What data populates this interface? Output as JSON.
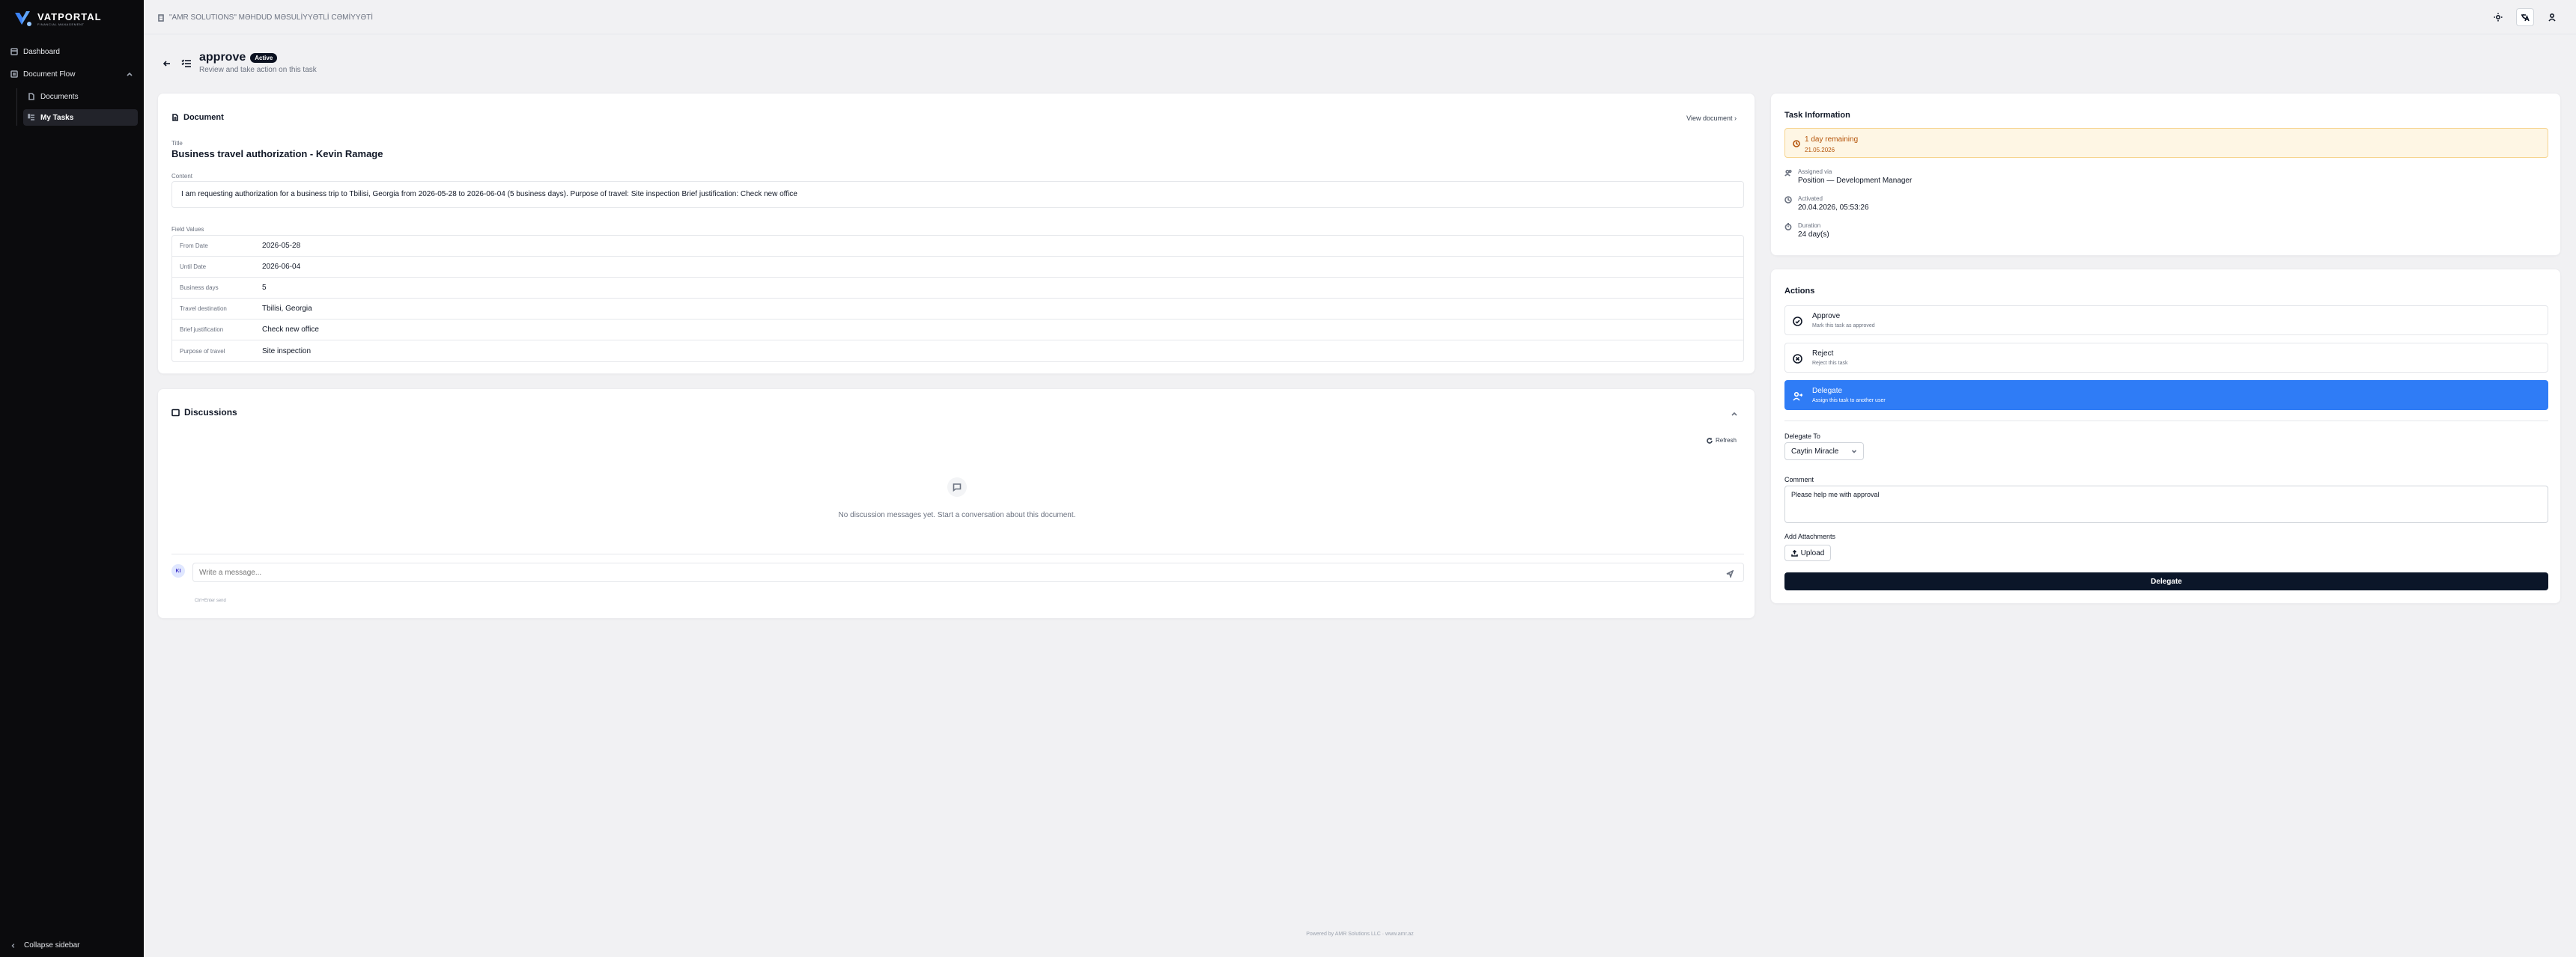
{
  "brand": {
    "name": "VATPORTAL",
    "tagline": "FINANCIAL MANAGEMENT"
  },
  "sidebar": {
    "items": [
      {
        "label": "Dashboard"
      },
      {
        "label": "Document Flow"
      },
      {
        "label": "Documents"
      },
      {
        "label": "My Tasks"
      }
    ],
    "collapse_label": "Collapse sidebar"
  },
  "topbar": {
    "company": "\"AMR SOLUTIONS\" MƏHDUD MƏSULİYYƏTLİ CƏMİYYƏTİ"
  },
  "header": {
    "title": "approve",
    "badge": "Active",
    "subtitle": "Review and take action on this task"
  },
  "document": {
    "heading": "Document",
    "view_label": "View document",
    "title_label": "Title",
    "title": "Business travel authorization - Kevin Ramage",
    "content_label": "Content",
    "content": "I am requesting authorization for a business trip to Tbilisi, Georgia from 2026-05-28 to 2026-06-04 (5 business days). Purpose of travel: Site inspection Brief justification: Check new office",
    "fields_label": "Field Values",
    "fields": [
      {
        "key": "From Date",
        "value": "2026-05-28"
      },
      {
        "key": "Until Date",
        "value": "2026-06-04"
      },
      {
        "key": "Business days",
        "value": "5"
      },
      {
        "key": "Travel destination",
        "value": "Tbilisi, Georgia"
      },
      {
        "key": "Brief justification",
        "value": "Check new office"
      },
      {
        "key": "Purpose of travel",
        "value": "Site inspection"
      }
    ]
  },
  "discussions": {
    "heading": "Discussions",
    "refresh_label": "Refresh",
    "empty_text": "No discussion messages yet. Start a conversation about this document.",
    "avatar_initials": "KI",
    "input_placeholder": "Write a message...",
    "hint": "Ctrl+Enter send"
  },
  "task_info": {
    "heading": "Task Information",
    "remaining": "1 day remaining",
    "deadline": "21.05.2026",
    "assigned_label": "Assigned via",
    "assigned_value": "Position — Development Manager",
    "activated_label": "Activated",
    "activated_value": "20.04.2026, 05:53:26",
    "duration_label": "Duration",
    "duration_value": "24 day(s)"
  },
  "actions": {
    "heading": "Actions",
    "options": [
      {
        "title": "Approve",
        "subtitle": "Mark this task as approved"
      },
      {
        "title": "Reject",
        "subtitle": "Reject this task"
      },
      {
        "title": "Delegate",
        "subtitle": "Assign this task to another user"
      }
    ],
    "selected": "Delegate",
    "delegate_to_label": "Delegate To",
    "delegate_to_value": "Caytin Miracle",
    "comment_label": "Comment",
    "comment_value": "Please help me with approval",
    "attachments_label": "Add Attachments",
    "upload_label": "Upload",
    "submit_label": "Delegate"
  },
  "footer": {
    "text": "Powered by AMR Solutions LLC · www.amr.az"
  },
  "colors": {
    "accent": "#2f7cf6",
    "sidebar_bg": "#0b0b0d",
    "warning_bg": "#fef6e4",
    "primary_btn": "#0b1629"
  }
}
